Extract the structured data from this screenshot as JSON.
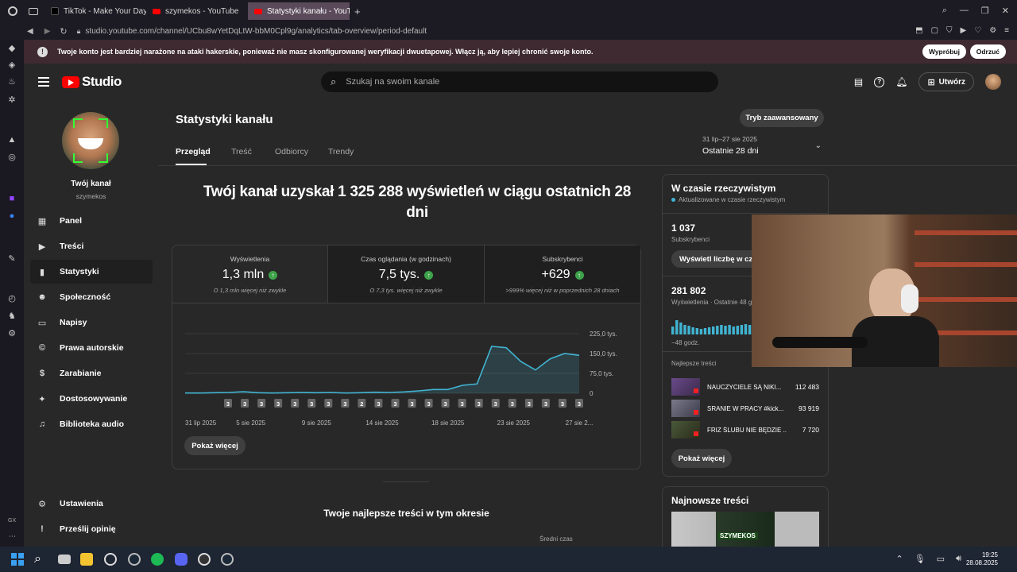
{
  "browser": {
    "tabs": [
      {
        "label": "TikTok - Make Your Day",
        "icon": "tiktok-icon"
      },
      {
        "label": "szymekos - YouTube",
        "icon": "youtube-icon"
      },
      {
        "label": "Statystyki kanału - YouTub",
        "icon": "youtube-icon",
        "active": true
      }
    ],
    "url": "studio.youtube.com/channel/UCbu8wYetDqLtW-bbM0Cpl9g/analytics/tab-overview/period-default"
  },
  "alert": {
    "message": "Twoje konto jest bardziej narażone na ataki hakerskie, ponieważ nie masz skonfigurowanej weryfikacji dwuetapowej. Włącz ją, aby lepiej chronić swoje konto.",
    "try_label": "Wypróbuj",
    "dismiss_label": "Odrzuć"
  },
  "header": {
    "logo_text": "Studio",
    "search_placeholder": "Szukaj na swoim kanale",
    "create_label": "Utwórz"
  },
  "channel": {
    "name": "Twój kanał",
    "handle": "szymekos"
  },
  "nav": {
    "items": [
      {
        "label": "Panel",
        "icon": "dashboard-icon"
      },
      {
        "label": "Treści",
        "icon": "content-icon"
      },
      {
        "label": "Statystyki",
        "icon": "analytics-icon",
        "active": true
      },
      {
        "label": "Społeczność",
        "icon": "community-icon"
      },
      {
        "label": "Napisy",
        "icon": "subtitles-icon"
      },
      {
        "label": "Prawa autorskie",
        "icon": "copyright-icon"
      },
      {
        "label": "Zarabianie",
        "icon": "dollar-icon"
      },
      {
        "label": "Dostosowywanie",
        "icon": "magic-wand-icon"
      },
      {
        "label": "Biblioteka audio",
        "icon": "audio-library-icon"
      }
    ],
    "settings_label": "Ustawienia",
    "feedback_label": "Prześlij opinię"
  },
  "page": {
    "title": "Statystyki kanału",
    "advanced_label": "Tryb zaawansowany",
    "tabs": [
      "Przegląd",
      "Treść",
      "Odbiorcy",
      "Trendy"
    ],
    "date_range": "31 lip–27 sie 2025",
    "date_period": "Ostatnie 28 dni"
  },
  "overview": {
    "headline": "Twój kanał uzyskał 1 325 288 wyświetleń w ciągu ostatnich 28 dni",
    "metrics": [
      {
        "label": "Wyświetlenia",
        "value": "1,3 mln",
        "sub": "O 1,3 mln więcej niż zwykle"
      },
      {
        "label": "Czas oglądania (w godzinach)",
        "value": "7,5 tys.",
        "sub": "O 7,3 tys. więcej niż zwykle"
      },
      {
        "label": "Subskrybenci",
        "value": "+629",
        "sub": ">999% więcej niż w poprzednich 28 dniach"
      }
    ],
    "show_more_label": "Pokaż więcej",
    "top_content_title": "Twoje najlepsze treści w tym okresie",
    "avg_time_label": "Średni czas"
  },
  "chart_data": {
    "type": "area",
    "x": [
      "31 lip",
      "1 sie",
      "2 sie",
      "3 sie",
      "4 sie",
      "5 sie",
      "6 sie",
      "7 sie",
      "8 sie",
      "9 sie",
      "10 sie",
      "11 sie",
      "12 sie",
      "13 sie",
      "14 sie",
      "15 sie",
      "16 sie",
      "17 sie",
      "18 sie",
      "19 sie",
      "20 sie",
      "21 sie",
      "22 sie",
      "23 sie",
      "24 sie",
      "25 sie",
      "26 sie",
      "27 sie"
    ],
    "x_tick_labels": [
      "31 lip 2025",
      "5 sie 2025",
      "9 sie 2025",
      "14 sie 2025",
      "18 sie 2025",
      "23 sie 2025",
      "27 sie 2..."
    ],
    "values": [
      1000,
      1000,
      2000,
      3000,
      6000,
      2000,
      1000,
      2000,
      3000,
      2000,
      3000,
      1000,
      2000,
      4000,
      3000,
      5000,
      9000,
      14000,
      14000,
      30000,
      35000,
      177000,
      172000,
      120000,
      88000,
      130000,
      150000,
      143000
    ],
    "y_tick_labels": [
      "225,0 tys.",
      "150,0 tys.",
      "75,0 tys.",
      "0"
    ],
    "ylim": [
      0,
      225000
    ],
    "markers": [
      "3",
      "3",
      "3",
      "3",
      "3",
      "3",
      "3",
      "3",
      "2",
      "3",
      "3",
      "3",
      "3",
      "3",
      "3",
      "3",
      "3",
      "3",
      "3",
      "3",
      "3",
      "3"
    ],
    "color": "#41b4d2",
    "grid": true
  },
  "realtime": {
    "title": "W czasie rzeczywistym",
    "subtitle": "Aktualizowane w czasie rzeczywistym",
    "subs_value": "1 037",
    "subs_label": "Subskrybenci",
    "show_count_label": "Wyświetl liczbę w czasie rzeczywistym",
    "views_value": "281 802",
    "views_label": "Wyświetlenia · Ostatnie 48 godz.",
    "hours_label": "−48 godz.",
    "top_label": "Najlepsze treści",
    "top_items": [
      {
        "title": "NAUCZYCIELE SĄ NIKI...",
        "views": "112 483"
      },
      {
        "title": "SRANIE W PRACY #kick...",
        "views": "93 919"
      },
      {
        "title": "FRIZ ŚLUBU NIE BĘDZIE ...",
        "views": "7 720"
      }
    ],
    "show_more_label": "Pokaż więcej"
  },
  "latest": {
    "title": "Najnowsze treści",
    "thumb_text": "SZYMEKOS"
  },
  "taskbar": {
    "time": "19:25",
    "date": "28.08.2025"
  }
}
